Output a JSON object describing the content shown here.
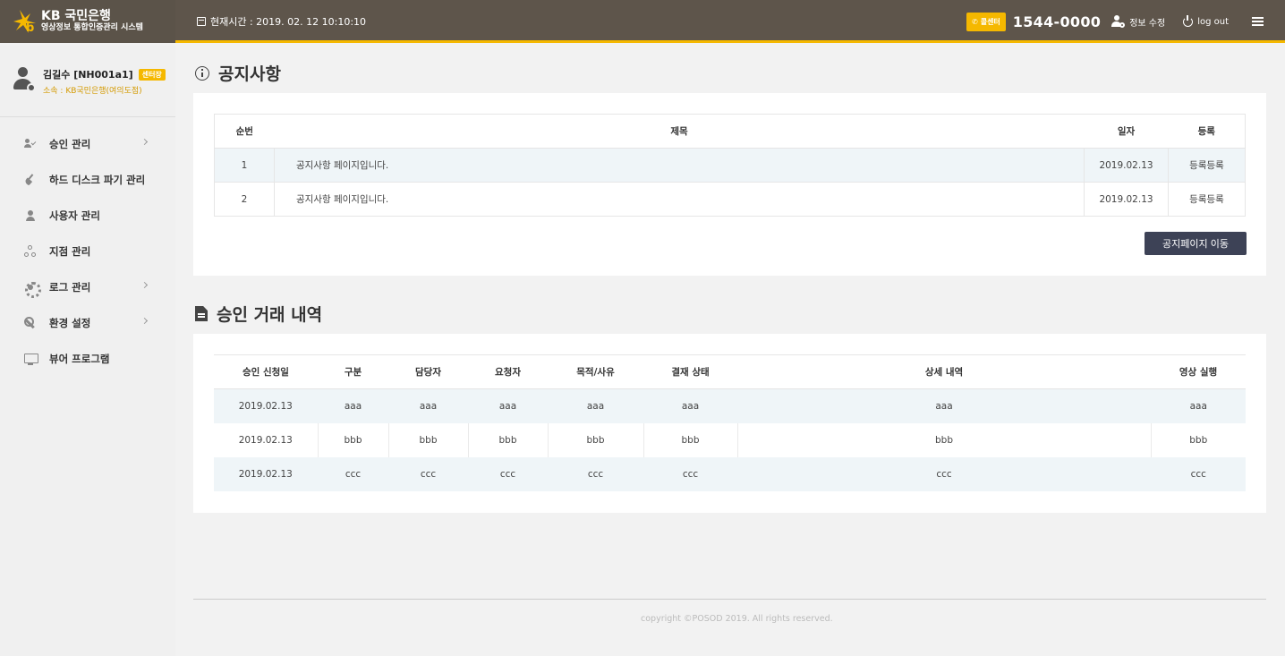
{
  "header": {
    "brand_line1": "KB 국민은행",
    "brand_line2": "영상정보 통합인증관리 시스템",
    "clock_text": "현재시간 : 2019. 02. 12 10:10:10",
    "call_center_label": "콜센터",
    "phone_number": "1544-0000",
    "profile_edit_label": "정보 수정",
    "logout_label": "log out",
    "accent_color": "#f5b800",
    "header_bg": "#5e554b"
  },
  "profile": {
    "name": "김길수 [NH001a1]",
    "role_badge": "센터장",
    "org": "소속 : KB국민은행(여의도점)"
  },
  "sidebar": {
    "items": [
      {
        "label": "승인 관리",
        "icon": "user-check-icon",
        "has_submenu": true
      },
      {
        "label": "하드 디스크 파기 관리",
        "icon": "brush-icon",
        "has_submenu": false
      },
      {
        "label": "사용자 관리",
        "icon": "person-icon",
        "has_submenu": false
      },
      {
        "label": "지점 관리",
        "icon": "sitemap-icon",
        "has_submenu": false
      },
      {
        "label": "로그 관리",
        "icon": "gear-icon",
        "has_submenu": true
      },
      {
        "label": "환경 설정",
        "icon": "wrench-icon",
        "has_submenu": true
      },
      {
        "label": "뷰어 프로그램",
        "icon": "monitor-icon",
        "has_submenu": false
      }
    ]
  },
  "notice": {
    "title": "공지사항",
    "columns": [
      "순번",
      "제목",
      "일자",
      "등록"
    ],
    "rows": [
      {
        "no": "1",
        "title": "공지사항 페이지입니다.",
        "date": "2019.02.13",
        "reg": "등록등록"
      },
      {
        "no": "2",
        "title": "공지사항 페이지입니다.",
        "date": "2019.02.13",
        "reg": "등록등록"
      }
    ],
    "button_label": "공지페이지 이동"
  },
  "approvals": {
    "title": "승인 거래 내역",
    "columns": [
      "승인 신청일",
      "구분",
      "담당자",
      "요청자",
      "목적/사유",
      "결재 상태",
      "상세 내역",
      "영상 실행"
    ],
    "rows": [
      [
        "2019.02.13",
        "aaa",
        "aaa",
        "aaa",
        "aaa",
        "aaa",
        "aaa",
        "aaa"
      ],
      [
        "2019.02.13",
        "bbb",
        "bbb",
        "bbb",
        "bbb",
        "bbb",
        "bbb",
        "bbb"
      ],
      [
        "2019.02.13",
        "ccc",
        "ccc",
        "ccc",
        "ccc",
        "ccc",
        "ccc",
        "ccc"
      ]
    ]
  },
  "footer": {
    "copyright": "copyright ©POSOD 2019. All rights reserved."
  }
}
